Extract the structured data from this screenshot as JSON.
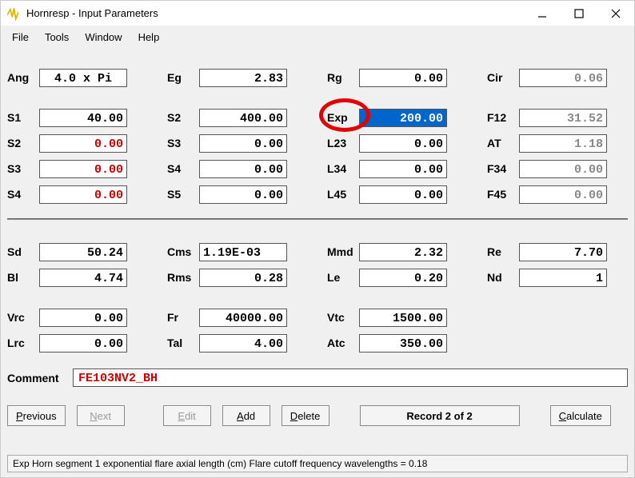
{
  "window": {
    "title": "Hornresp - Input Parameters"
  },
  "menu": {
    "file": "File",
    "tools": "Tools",
    "window": "Window",
    "help": "Help"
  },
  "rows1": {
    "c1": {
      "l1": "Ang",
      "v1": "4.0 x Pi",
      "l2": "Eg",
      "v2": "2.83",
      "l3": "Rg",
      "v3": "0.00",
      "l4": "Cir",
      "v4": "0.06"
    },
    "c2": {
      "l1": "S1",
      "v1": "40.00",
      "l2": "S2",
      "v2": "400.00",
      "l3": "Exp",
      "v3": "200.00",
      "l4": "F12",
      "v4": "31.52"
    },
    "c3": {
      "l1": "S2",
      "v1": "0.00",
      "l2": "S3",
      "v2": "0.00",
      "l3": "L23",
      "v3": "0.00",
      "l4": "AT",
      "v4": "1.18"
    },
    "c4": {
      "l1": "S3",
      "v1": "0.00",
      "l2": "S4",
      "v2": "0.00",
      "l3": "L34",
      "v3": "0.00",
      "l4": "F34",
      "v4": "0.00"
    },
    "c5": {
      "l1": "S4",
      "v1": "0.00",
      "l2": "S5",
      "v2": "0.00",
      "l3": "L45",
      "v3": "0.00",
      "l4": "F45",
      "v4": "0.00"
    }
  },
  "rows2": {
    "c1": {
      "l1": "Sd",
      "v1": "50.24",
      "l2": "Cms",
      "v2": "1.19E-03",
      "l3": "Mmd",
      "v3": "2.32",
      "l4": "Re",
      "v4": "7.70"
    },
    "c2": {
      "l1": "Bl",
      "v1": "4.74",
      "l2": "Rms",
      "v2": "0.28",
      "l3": "Le",
      "v3": "0.20",
      "l4": "Nd",
      "v4": "1"
    },
    "c3": {
      "l1": "Vrc",
      "v1": "0.00",
      "l2": "Fr",
      "v2": "40000.00",
      "l3": "Vtc",
      "v3": "1500.00"
    },
    "c4": {
      "l1": "Lrc",
      "v1": "0.00",
      "l2": "Tal",
      "v2": "4.00",
      "l3": "Atc",
      "v3": "350.00"
    }
  },
  "comment": {
    "label": "Comment",
    "value": "FE103NV2_BH"
  },
  "buttons": {
    "previous": "Previous",
    "next": "Next",
    "edit": "Edit",
    "add": "Add",
    "delete": "Delete",
    "record": "Record 2 of 2",
    "calculate": "Calculate"
  },
  "status": "Exp   Horn segment 1 exponential flare axial length  (cm)   Flare cutoff frequency wavelengths = 0.18"
}
